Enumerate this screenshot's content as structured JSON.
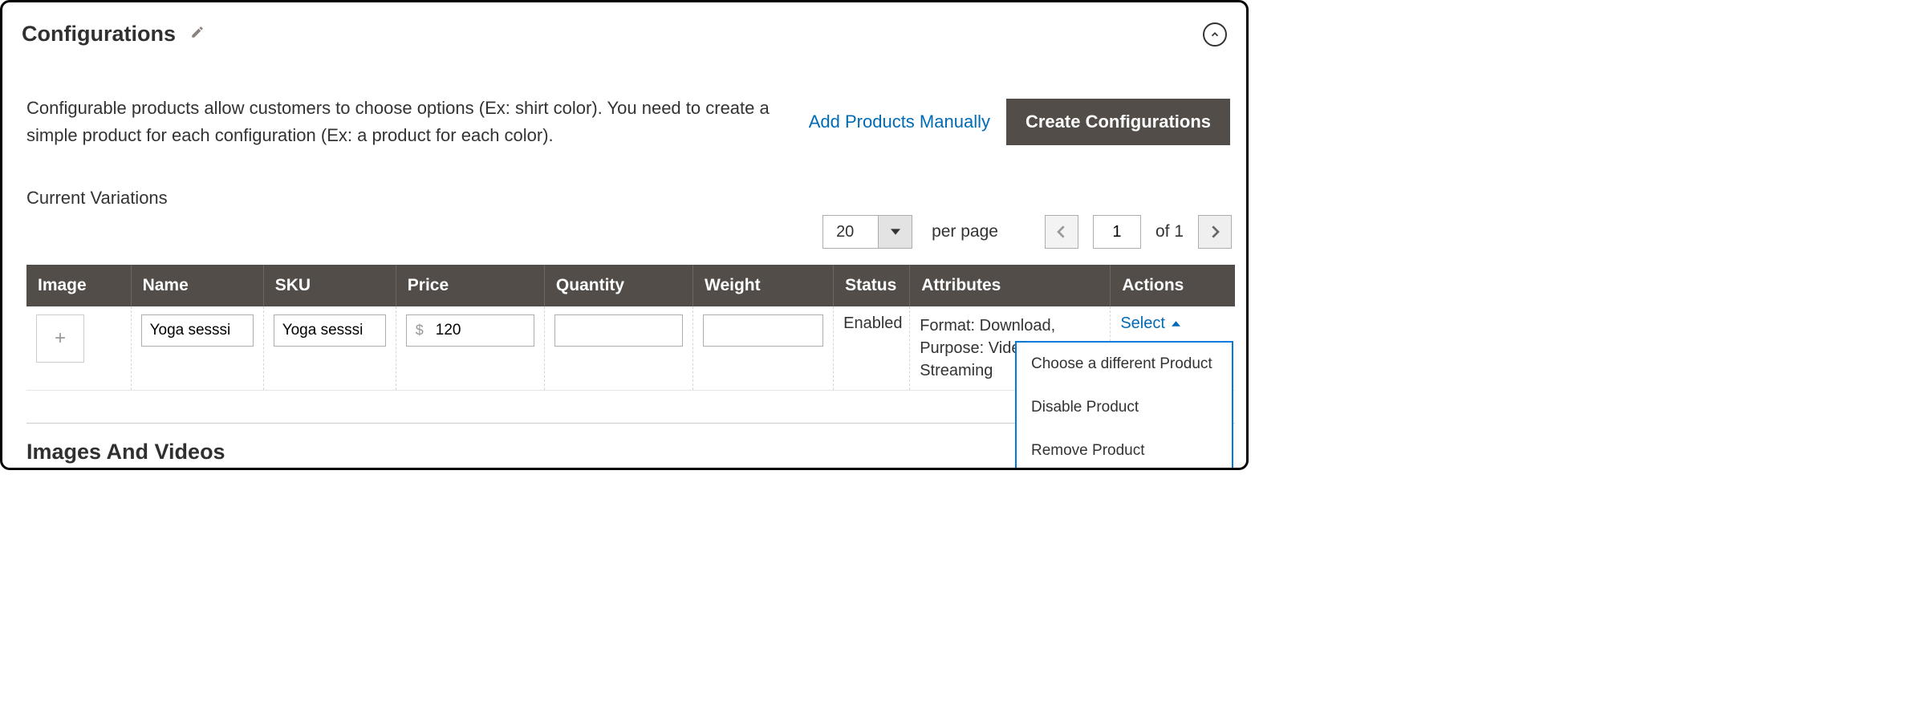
{
  "header": {
    "title": "Configurations"
  },
  "intro": {
    "text": "Configurable products allow customers to choose options (Ex: shirt color). You need to create a simple product for each configuration (Ex: a product for each color).",
    "addProductsLabel": "Add Products Manually",
    "createConfigLabel": "Create Configurations"
  },
  "currentVariations": {
    "title": "Current Variations",
    "perPageValue": "20",
    "perPageLabel": "per page",
    "pageValue": "1",
    "pageOf": "of 1"
  },
  "columns": {
    "image": "Image",
    "name": "Name",
    "sku": "SKU",
    "price": "Price",
    "quantity": "Quantity",
    "weight": "Weight",
    "status": "Status",
    "attributes": "Attributes",
    "actions": "Actions"
  },
  "row": {
    "name": "Yoga sesssi",
    "sku": "Yoga sesssi",
    "pricePrefix": "$",
    "price": "120",
    "quantity": "",
    "weight": "",
    "status": "Enabled",
    "attributes": "Format: Download, Purpose: Video Streaming",
    "actionLabel": "Select"
  },
  "dropdown": {
    "choose": "Choose a different Product",
    "disable": "Disable Product",
    "remove": "Remove Product"
  },
  "bottomSection": {
    "title": "Images And Videos"
  }
}
